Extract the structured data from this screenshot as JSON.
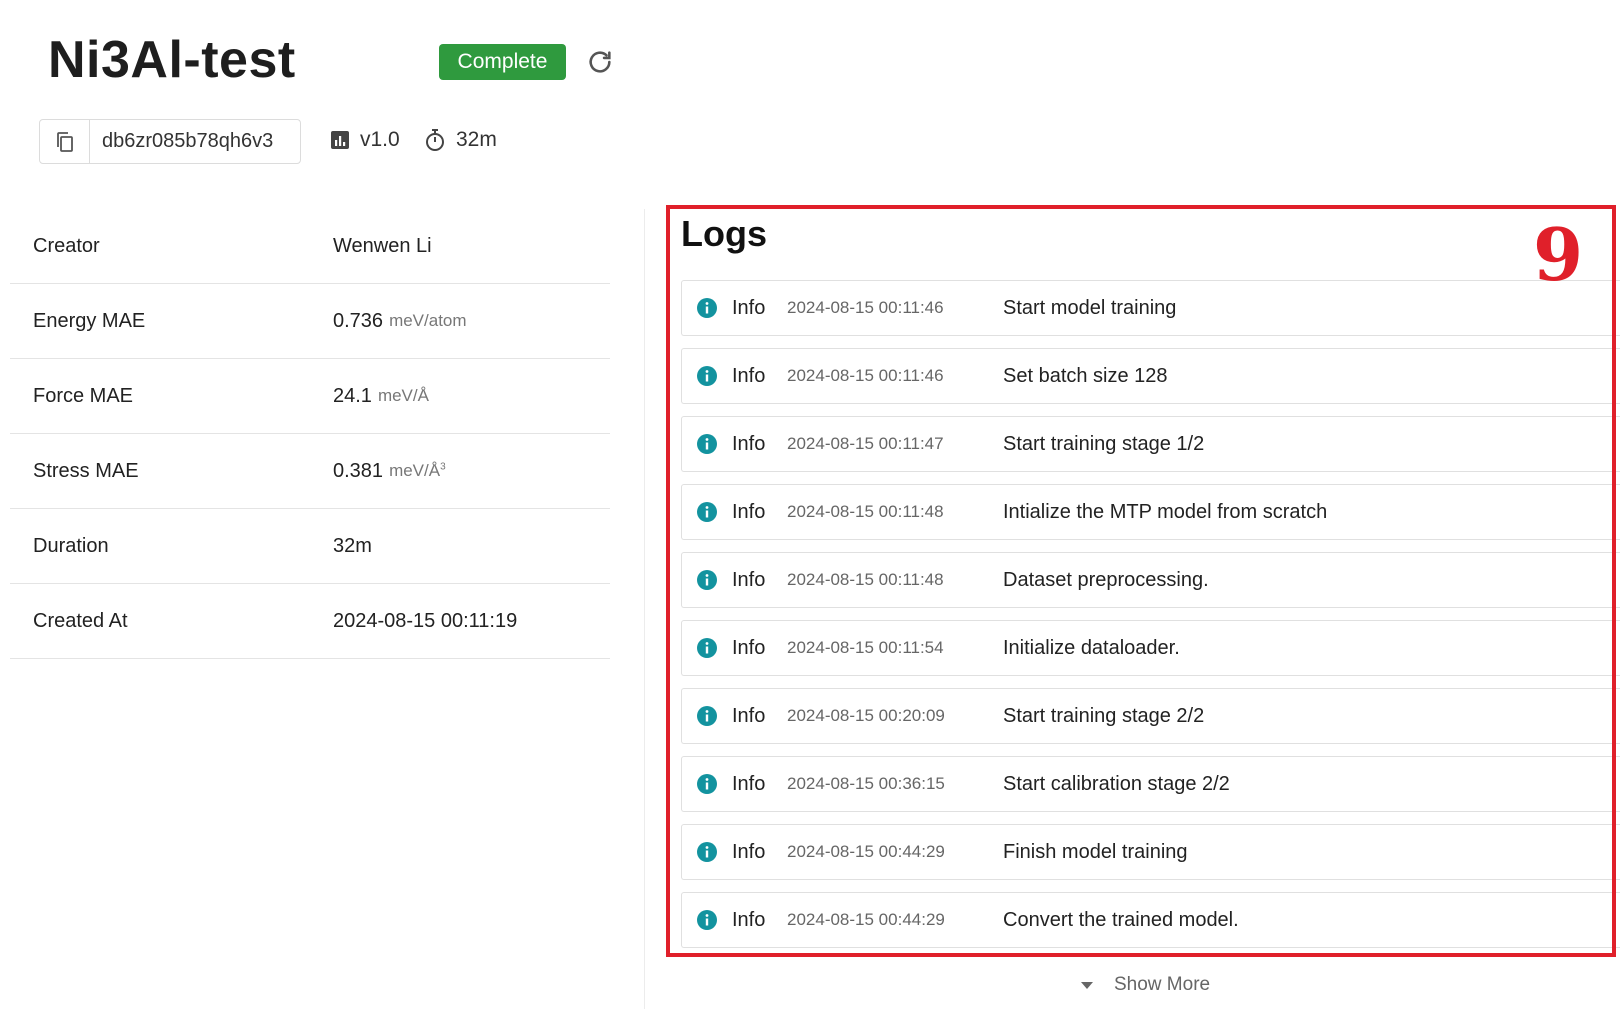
{
  "header": {
    "title": "Ni3Al-test",
    "status": "Complete",
    "id": "db6zr085b78qh6v3",
    "version": "v1.0",
    "duration": "32m"
  },
  "properties": [
    {
      "label": "Creator",
      "value": "Wenwen Li",
      "unit": ""
    },
    {
      "label": "Energy MAE",
      "value": "0.736",
      "unit": "meV/atom"
    },
    {
      "label": "Force MAE",
      "value": "24.1",
      "unit": "meV/Å"
    },
    {
      "label": "Stress MAE",
      "value": "0.381",
      "unit": "meV/Å",
      "unit_sup": "3"
    },
    {
      "label": "Duration",
      "value": "32m",
      "unit": ""
    },
    {
      "label": "Created At",
      "value": "2024-08-15 00:11:19",
      "unit": ""
    }
  ],
  "logs": {
    "title": "Logs",
    "annotation": "9",
    "entries": [
      {
        "level": "Info",
        "timestamp": "2024-08-15 00:11:46",
        "message": "Start model training"
      },
      {
        "level": "Info",
        "timestamp": "2024-08-15 00:11:46",
        "message": "Set batch size 128"
      },
      {
        "level": "Info",
        "timestamp": "2024-08-15 00:11:47",
        "message": "Start training stage 1/2"
      },
      {
        "level": "Info",
        "timestamp": "2024-08-15 00:11:48",
        "message": "Intialize the MTP model from scratch"
      },
      {
        "level": "Info",
        "timestamp": "2024-08-15 00:11:48",
        "message": "Dataset preprocessing."
      },
      {
        "level": "Info",
        "timestamp": "2024-08-15 00:11:54",
        "message": "Initialize dataloader."
      },
      {
        "level": "Info",
        "timestamp": "2024-08-15 00:20:09",
        "message": "Start training stage 2/2"
      },
      {
        "level": "Info",
        "timestamp": "2024-08-15 00:36:15",
        "message": "Start calibration stage 2/2"
      },
      {
        "level": "Info",
        "timestamp": "2024-08-15 00:44:29",
        "message": "Finish model training"
      },
      {
        "level": "Info",
        "timestamp": "2024-08-15 00:44:29",
        "message": "Convert the trained model."
      }
    ],
    "show_more": "Show More"
  },
  "colors": {
    "status_green": "#2f9a3e",
    "info_teal": "#13939f",
    "highlight_red": "#e0202a"
  },
  "icons": {
    "copy": "copy-icon",
    "refresh": "refresh-icon",
    "version": "bar-chart-icon",
    "duration": "stopwatch-icon",
    "log_level": "info-circle-icon",
    "show_more": "caret-down-icon"
  }
}
